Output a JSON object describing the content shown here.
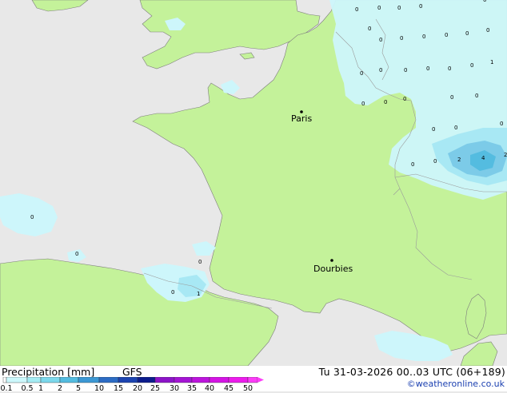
{
  "map": {
    "cities": [
      {
        "name": "Paris"
      },
      {
        "name": "Dourbies"
      }
    ],
    "point_values": [
      "0",
      "0",
      "0",
      "0",
      "0",
      "0",
      "0",
      "0",
      "0",
      "0",
      "0",
      "0",
      "0",
      "0",
      "0",
      "0",
      "0",
      "0",
      "0",
      "0",
      "0",
      "0",
      "0",
      "0",
      "0",
      "1",
      "2",
      "4",
      "2",
      "0",
      "0",
      "0",
      "1",
      "0",
      "0",
      "0",
      "0"
    ]
  },
  "footer": {
    "title": "Precipitation [mm]",
    "model": "GFS",
    "valid": "Tu 31-03-2026 00..03 UTC (06+189)",
    "credit": "©weatheronline.co.uk"
  },
  "legend": {
    "ticks": [
      "0.1",
      "0.5",
      "1",
      "2",
      "5",
      "10",
      "15",
      "20",
      "25",
      "30",
      "35",
      "40",
      "45",
      "50"
    ],
    "colors": [
      "#ffffff",
      "#ccf8fc",
      "#a4ecf4",
      "#7cd8ec",
      "#54bce0",
      "#3c98d4",
      "#2c6cc4",
      "#1c44b0",
      "#0c1c8c",
      "#8c14c8",
      "#a414d4",
      "#bc14dc",
      "#d414e4",
      "#ec1cec",
      "#fc3cf8"
    ]
  },
  "colors": {
    "land": "#c4f29a",
    "sea": "#e8e8e8",
    "precip_light": "#cdf6fb",
    "precip_mid": "#a8e8f4",
    "precip_heavy": "#7ccbe8"
  }
}
